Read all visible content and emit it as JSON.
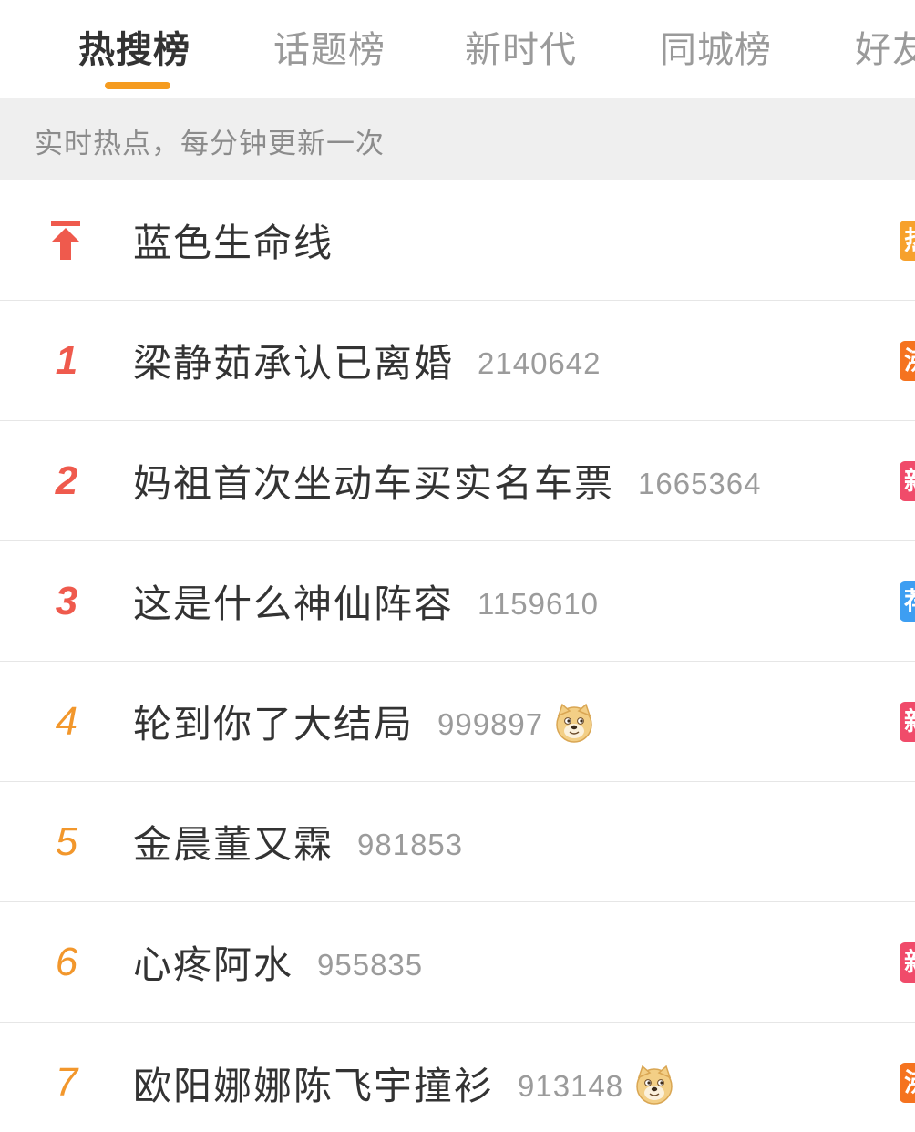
{
  "tabs": [
    "热搜榜",
    "话题榜",
    "新时代",
    "同城榜",
    "好友"
  ],
  "subheader": "实时热点，每分钟更新一次",
  "colors": {
    "accent": "#f59b1f",
    "rank_top": "#ef5a4d",
    "rank_other": "#f2972c",
    "badge_hot": "#f7a12c",
    "badge_boil": "#f5731f",
    "badge_new": "#f04b6a",
    "badge_recommend": "#3d9ef2"
  },
  "items": [
    {
      "rank": "",
      "pinned": true,
      "title": "蓝色生命线",
      "count": "",
      "emoji": false,
      "badge": "热",
      "badge_color": "#f7a12c"
    },
    {
      "rank": "1",
      "pinned": false,
      "title": "梁静茹承认已离婚",
      "count": "2140642",
      "emoji": false,
      "badge": "沸",
      "badge_color": "#f5731f"
    },
    {
      "rank": "2",
      "pinned": false,
      "title": "妈祖首次坐动车买实名车票",
      "count": "1665364",
      "emoji": false,
      "badge": "新",
      "badge_color": "#f04b6a"
    },
    {
      "rank": "3",
      "pinned": false,
      "title": "这是什么神仙阵容",
      "count": "1159610",
      "emoji": false,
      "badge": "荐",
      "badge_color": "#3d9ef2"
    },
    {
      "rank": "4",
      "pinned": false,
      "title": "轮到你了大结局",
      "count": "999897",
      "emoji": true,
      "badge": "新",
      "badge_color": "#f04b6a"
    },
    {
      "rank": "5",
      "pinned": false,
      "title": "金晨董又霖",
      "count": "981853",
      "emoji": false,
      "badge": "",
      "badge_color": ""
    },
    {
      "rank": "6",
      "pinned": false,
      "title": "心疼阿水",
      "count": "955835",
      "emoji": false,
      "badge": "新",
      "badge_color": "#f04b6a"
    },
    {
      "rank": "7",
      "pinned": false,
      "title": "欧阳娜娜陈飞宇撞衫",
      "count": "913148",
      "emoji": true,
      "badge": "沸",
      "badge_color": "#f5731f"
    }
  ]
}
